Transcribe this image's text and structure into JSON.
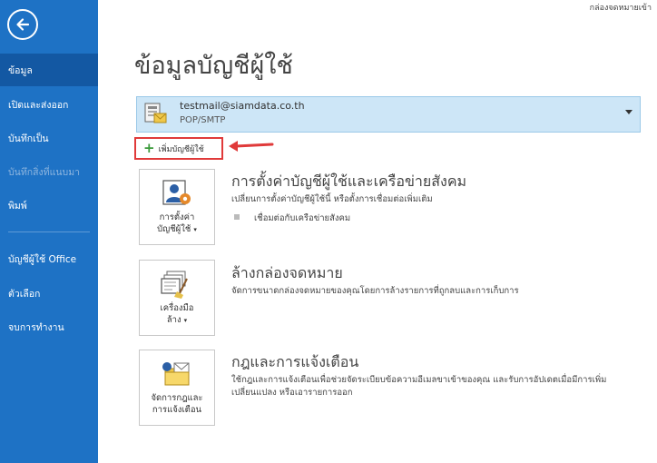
{
  "window": {
    "top_right_label": "กล่องจดหมายเข้า"
  },
  "sidebar": {
    "items": [
      {
        "label": "ข้อมูล",
        "active": true,
        "disabled": false
      },
      {
        "label": "เปิดและส่งออก",
        "active": false,
        "disabled": false
      },
      {
        "label": "บันทึกเป็น",
        "active": false,
        "disabled": false
      },
      {
        "label": "บันทึกสิ่งที่แนบมา",
        "active": false,
        "disabled": true
      },
      {
        "label": "พิมพ์",
        "active": false,
        "disabled": false
      },
      {
        "label": "บัญชีผู้ใช้ Office",
        "active": false,
        "disabled": false
      },
      {
        "label": "ตัวเลือก",
        "active": false,
        "disabled": false
      },
      {
        "label": "จบการทำงาน",
        "active": false,
        "disabled": false
      }
    ]
  },
  "main": {
    "title": "ข้อมูลบัญชีผู้ใช้",
    "account": {
      "email": "testmail@siamdata.co.th",
      "type": "POP/SMTP"
    },
    "add_account_label": "เพิ่มบัญชีผู้ใช้",
    "sections": [
      {
        "tile_line1": "การตั้งค่า",
        "tile_line2": "บัญชีผู้ใช้",
        "title": "การตั้งค่าบัญชีผู้ใช้และเครือข่ายสังคม",
        "desc1": "เปลี่ยนการตั้งค่าบัญชีผู้ใช้นี้ หรือตั้งการเชื่อมต่อเพิ่มเติม",
        "desc2": "",
        "sub": "เชื่อมต่อกับเครือข่ายสังคม"
      },
      {
        "tile_line1": "เครื่องมือ",
        "tile_line2": "ล้าง",
        "title": "ล้างกล่องจดหมาย",
        "desc1": "จัดการขนาดกล่องจดหมายของคุณโดยการล้างรายการที่ถูกลบและการเก็บการ",
        "desc2": ""
      },
      {
        "tile_line1": "จัดการกฎและ",
        "tile_line2": "การแจ้งเตือน",
        "title": "กฎและการแจ้งเตือน",
        "desc1": "ใช้กฎและการแจ้งเตือนเพื่อช่วยจัดระเบียบข้อความอีเมลขาเข้าของคุณ และรับการอัปเดตเมื่อมีการเพิ่ม",
        "desc2": "เปลี่ยนแปลง หรือเอารายการออก"
      }
    ]
  },
  "colors": {
    "sidebar": "#1e72c5",
    "sidebar_active": "#1358a3",
    "account_bg": "#cde6f7",
    "highlight": "#e03a3a"
  }
}
